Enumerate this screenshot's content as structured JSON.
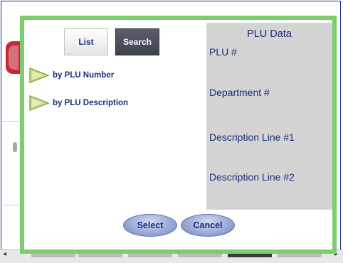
{
  "tabs": {
    "list_label": "List",
    "search_label": "Search"
  },
  "search_options": [
    {
      "label": "by PLU Number",
      "icon": "arrow-right-icon"
    },
    {
      "label": "by PLU Description",
      "icon": "arrow-right-icon"
    }
  ],
  "plu_data": {
    "title": "PLU Data",
    "fields": [
      "PLU #",
      "Department #",
      "Description Line #1",
      "Description Line #2"
    ]
  },
  "actions": {
    "select_label": "Select",
    "cancel_label": "Cancel"
  },
  "colors": {
    "dialog_border": "#7ccd6c",
    "panel_bg": "#d4d4d4",
    "text_blue": "#1a2f7a",
    "arrow_fill": "#c9e08a"
  }
}
